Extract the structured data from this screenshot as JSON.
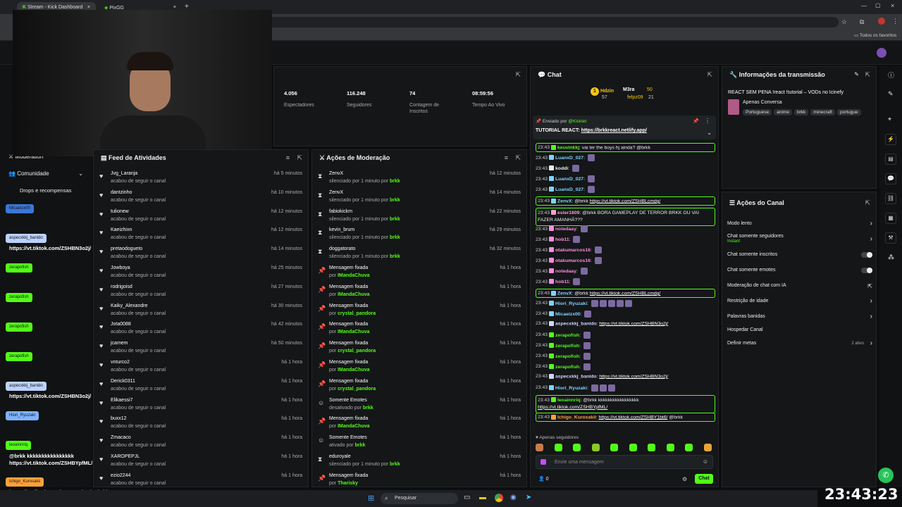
{
  "browser": {
    "tabs": [
      {
        "label": "Stream - Kick Dashboard"
      },
      {
        "label": "PixGG"
      }
    ],
    "bookmarks_label": "Todos os favoritos"
  },
  "sidebar": {
    "items": [
      {
        "label": "Moderation"
      },
      {
        "label": "Comunidade"
      },
      {
        "label": "Drops e recompensas"
      }
    ]
  },
  "stats": [
    {
      "value": "4.056",
      "label": "Espectadores"
    },
    {
      "value": "116.248",
      "label": "Seguidores"
    },
    {
      "value": "74",
      "label": "Contagem de Inscritos"
    },
    {
      "value": "08:59:56",
      "label": "Tempo Ao Vivo"
    }
  ],
  "activity": {
    "title": "Feed de Atividades",
    "items": [
      {
        "user": "Jvg_Laranja",
        "action": "acabou de seguir o canal",
        "time": "há 5 minutos"
      },
      {
        "user": "dantzinho",
        "action": "acabou de seguir o canal",
        "time": "há 10 minutos"
      },
      {
        "user": "tulionew",
        "action": "acabou de seguir o canal",
        "time": "há 12 minutos"
      },
      {
        "user": "Kaeizhixn",
        "action": "acabou de seguir o canal",
        "time": "há 12 minutos"
      },
      {
        "user": "pretaodogueto",
        "action": "acabou de seguir o canal",
        "time": "há 14 minutos"
      },
      {
        "user": "Jowboya",
        "action": "acabou de seguir o canal",
        "time": "há 25 minutos"
      },
      {
        "user": "rodrigoisd",
        "action": "acabou de seguir o canal",
        "time": "há 27 minutos"
      },
      {
        "user": "Kaiky_Alexandre",
        "action": "acabou de seguir o canal",
        "time": "há 30 minutos"
      },
      {
        "user": "Jota0088",
        "action": "acabou de seguir o canal",
        "time": "há 42 minutos"
      },
      {
        "user": "jcamem",
        "action": "acabou de seguir o canal",
        "time": "há 50 minutos"
      },
      {
        "user": "vnturco2",
        "action": "acabou de seguir o canal",
        "time": "há 1 hora"
      },
      {
        "user": "Derick0311",
        "action": "acabou de seguir o canal",
        "time": "há 1 hora"
      },
      {
        "user": "Elikaessi7",
        "action": "acabou de seguir o canal",
        "time": "há 1 hora"
      },
      {
        "user": "buxx12",
        "action": "acabou de seguir o canal",
        "time": "há 1 hora"
      },
      {
        "user": "Zmacaco",
        "action": "acabou de seguir o canal",
        "time": "há 1 hora"
      },
      {
        "user": "XAROPEPJL",
        "action": "acabou de seguir o canal",
        "time": "há 1 hora"
      },
      {
        "user": "ezio2244",
        "action": "acabou de seguir o canal",
        "time": "há 1 hora"
      }
    ]
  },
  "moderation": {
    "title": "Ações de Moderação",
    "items": [
      {
        "icon": "⧗",
        "user": "ZenvX",
        "pre": "silenciado por 1 minuto por ",
        "by": "brkk",
        "time": "há 12 minutos"
      },
      {
        "icon": "⧗",
        "user": "ZenvX",
        "pre": "silenciado por 1 minuto por ",
        "by": "brkk",
        "time": "há 14 minutos"
      },
      {
        "icon": "⧗",
        "user": "fabiokickm",
        "pre": "silenciado por 1 minuto por ",
        "by": "brkk",
        "time": "há 22 minutos"
      },
      {
        "icon": "⧗",
        "user": "kevin_brum",
        "pre": "silenciado por 1 minuto por ",
        "by": "brkk",
        "time": "há 29 minutos"
      },
      {
        "icon": "⧗",
        "user": "doggatorato",
        "pre": "silenciado por 1 minuto por ",
        "by": "brkk",
        "time": "há 32 minutos"
      },
      {
        "icon": "📌",
        "user": "Mensagem fixada",
        "pre": "por ",
        "by": "IMandaChuva",
        "time": "há 1 hora"
      },
      {
        "icon": "📌",
        "user": "Mensagem fixada",
        "pre": "por ",
        "by": "IMandaChuva",
        "time": "há 1 hora"
      },
      {
        "icon": "📌",
        "user": "Mensagem fixada",
        "pre": "por ",
        "by": "crystal_pandora",
        "time": "há 1 hora"
      },
      {
        "icon": "📌",
        "user": "Mensagem fixada",
        "pre": "por ",
        "by": "IMandaChuva",
        "time": "há 1 hora"
      },
      {
        "icon": "📌",
        "user": "Mensagem fixada",
        "pre": "por ",
        "by": "crystal_pandora",
        "time": "há 1 hora"
      },
      {
        "icon": "📌",
        "user": "Mensagem fixada",
        "pre": "por ",
        "by": "IMandaChuva",
        "time": "há 1 hora"
      },
      {
        "icon": "📌",
        "user": "Mensagem fixada",
        "pre": "por ",
        "by": "crystal_pandora",
        "time": "há 1 hora"
      },
      {
        "icon": "☺",
        "user": "Somente Emotes",
        "pre": "desativado por ",
        "by": "brkk",
        "time": "há 1 hora"
      },
      {
        "icon": "📌",
        "user": "Mensagem fixada",
        "pre": "por ",
        "by": "IMandaChuva",
        "time": "há 1 hora"
      },
      {
        "icon": "☺",
        "user": "Somente Emotes",
        "pre": "ativado por ",
        "by": "brkk",
        "time": "há 1 hora"
      },
      {
        "icon": "⧗",
        "user": "eduroyale",
        "pre": "silenciado por 1 minuto por ",
        "by": "brkk",
        "time": "há 1 hora"
      },
      {
        "icon": "📌",
        "user": "Mensagem fixada",
        "pre": "por ",
        "by": "Tharisky",
        "time": "há 1 hora"
      }
    ]
  },
  "chat": {
    "title": "Chat",
    "leaderboard": [
      {
        "rank": "1",
        "name": "Hdzin",
        "count": "57"
      },
      {
        "name": "M3ra",
        "count": "50"
      },
      {
        "name": "felpz09",
        "count": "21"
      }
    ],
    "pinned": {
      "by_label": "Enviado por",
      "by_user": "@Kicklet",
      "text": "TUTORIAL REACT: ",
      "link": "https://brkkreact.netlify.app/"
    },
    "messages": [
      {
        "time": "23:43",
        "user": "keuvinkkj",
        "color": "#53fc18",
        "text": "vai ter the boys hj ainda? @brkk",
        "hl": true
      },
      {
        "time": "23:43",
        "user": "LuanxD_027",
        "color": "#7fd3ff",
        "text": "",
        "emotes": 1
      },
      {
        "time": "23:43",
        "user": "koddi",
        "color": "#eeeeee",
        "text": "",
        "emotes": 1
      },
      {
        "time": "23:43",
        "user": "LuanxD_027",
        "color": "#7fd3ff",
        "text": "",
        "emotes": 1
      },
      {
        "time": "23:43",
        "user": "LuanxD_027",
        "color": "#7fd3ff",
        "text": "",
        "emotes": 1
      },
      {
        "time": "23:43",
        "user": "ZenvX",
        "color": "#7fd3ff",
        "text": "@brkk ",
        "link": "https://vt.tiktok.com/ZSHBLcmdg/",
        "hl": true
      },
      {
        "time": "23:43",
        "user": "ester1809",
        "color": "#ff9bd0",
        "text": "@brkk BORA GAMEPLAY DE TERROR BRKK OU VAI FAZER AMANHÃ???",
        "hl": true
      },
      {
        "time": "23:43",
        "user": "notedaay",
        "color": "#ff8ae0",
        "text": "",
        "emotes": 1
      },
      {
        "time": "23:43",
        "user": "hob11",
        "color": "#ff8ae0",
        "text": "",
        "emotes": 1
      },
      {
        "time": "23:43",
        "user": "otakumarcos16",
        "color": "#ff8ae0",
        "text": "",
        "emotes": 1
      },
      {
        "time": "23:43",
        "user": "otakumarcos16",
        "color": "#ff8ae0",
        "text": "",
        "emotes": 1
      },
      {
        "time": "23:43",
        "user": "notedaay",
        "color": "#ff8ae0",
        "text": "",
        "emotes": 1
      },
      {
        "time": "23:43",
        "user": "hob11",
        "color": "#ff8ae0",
        "text": "",
        "emotes": 1
      },
      {
        "time": "23:43",
        "user": "ZenvX",
        "color": "#7fd3ff",
        "text": "@brkk ",
        "link": "https://vt.tiktok.com/ZSHBLcmdg/",
        "hl": true
      },
      {
        "time": "23:43",
        "user": "Hiori_Ryuzaki",
        "color": "#7fd3ff",
        "text": "",
        "emotes": 5
      },
      {
        "time": "23:43",
        "user": "Micaeizx00",
        "color": "#7fd3ff",
        "text": "",
        "emotes": 1
      },
      {
        "time": "23:43",
        "user": "aspecxkkj_banido",
        "color": "#cfd6ff",
        "text": "",
        "link": "https://vt.tiktok.com/ZSHBN3o2j/"
      },
      {
        "time": "23:43",
        "user": "zerapofish",
        "color": "#53fc18",
        "text": "",
        "emotes": 1
      },
      {
        "time": "23:43",
        "user": "zerapofish",
        "color": "#53fc18",
        "text": "",
        "emotes": 1
      },
      {
        "time": "23:43",
        "user": "zerapofish",
        "color": "#53fc18",
        "text": "",
        "emotes": 1
      },
      {
        "time": "23:43",
        "user": "zerapofish",
        "color": "#53fc18",
        "text": "",
        "emotes": 1
      },
      {
        "time": "23:43",
        "user": "aspecxkkj_banido",
        "color": "#cfd6ff",
        "text": "",
        "link": "https://vt.tiktok.com/ZSHBN3o2j/"
      },
      {
        "time": "23:43",
        "user": "Hiori_Ryuzaki",
        "color": "#7fd3ff",
        "text": "",
        "emotes": 3
      },
      {
        "time": "23:43",
        "user": "leoainnriq",
        "color": "#53fc18",
        "text": "@brkk kkkkkkkkkkkkkkkkk",
        "link2": "https://vt.tiktok.com/ZSHBYpfML/",
        "hl": true
      },
      {
        "time": "23:43",
        "user": "Ichigo_Kurosakii",
        "color": "#ffa23a",
        "text": "",
        "link": "https://vt.tiktok.com/ZSHBY1bt6/",
        "tail": " @brkk",
        "hl": true
      }
    ],
    "followers_only_label": "Apenas seguidores",
    "input_placeholder": "Envie uma mensagem",
    "viewer_count": "0",
    "send_label": "Chat"
  },
  "stream_info": {
    "title": "Informações da transmissão",
    "stream_title": "REACT SEM PENA !react !tutorial – VODs no Icinefy",
    "category": "Apenas Conversa",
    "tags": [
      "Portuguese",
      "anime",
      "brkk",
      "minecraft",
      "portugue"
    ]
  },
  "channel_actions": {
    "title": "Ações do Canal",
    "items": [
      {
        "label": "Modo lento",
        "type": "chevron"
      },
      {
        "label": "Chat somente seguidores",
        "sub": "Instant",
        "type": "chevron"
      },
      {
        "label": "Chat somente inscritos",
        "type": "toggle"
      },
      {
        "label": "Chat somente emotes",
        "type": "toggle"
      },
      {
        "label": "Moderação de chat com IA",
        "type": "link"
      },
      {
        "label": "Restrição de idade",
        "type": "chevron"
      },
      {
        "label": "Palavras banidas",
        "type": "chevron"
      },
      {
        "label": "Hospedar Canal",
        "type": "none"
      },
      {
        "label": "Definir metas",
        "badge": "2 ativo",
        "type": "chevron"
      }
    ]
  },
  "overlay": {
    "chips": [
      {
        "label": "Micaeizx00",
        "color": "#3a78d8"
      },
      {
        "label": "aspecxkkj_banido",
        "color": "#bcd2ff"
      },
      {
        "label": "zerapofish",
        "color": "#53fc18"
      },
      {
        "label": "zerapofish",
        "color": "#53fc18"
      },
      {
        "label": "zerapofish",
        "color": "#53fc18"
      },
      {
        "label": "zerapofish",
        "color": "#53fc18"
      },
      {
        "label": "aspecxkkj_banido",
        "color": "#bcd2ff"
      },
      {
        "label": "Hiori_Ryuzaki",
        "color": "#7fb3ff"
      },
      {
        "label": "leoainnriq",
        "color": "#53fc18"
      },
      {
        "label": "Ichigo_Kurosakii",
        "color": "#ffa23a"
      }
    ],
    "texts": [
      "https://vt.tiktok.com/ZSHBN3o2j/",
      "https://vt.tiktok.com/ZSHBN3o2j/",
      "@brkk kkkkkkkkkkkkkkkk",
      "https://vt.tiktok.com/ZSHBYpfML/",
      "https://vt.tiktok.com/ZSHBY1bt6/ @brkk"
    ],
    "clock": "23:43:23"
  },
  "taskbar": {
    "search_placeholder": "Pesquisar"
  },
  "colors": {
    "accent": "#53fc18",
    "panel": "#141618",
    "bg": "#0b0d0e"
  }
}
